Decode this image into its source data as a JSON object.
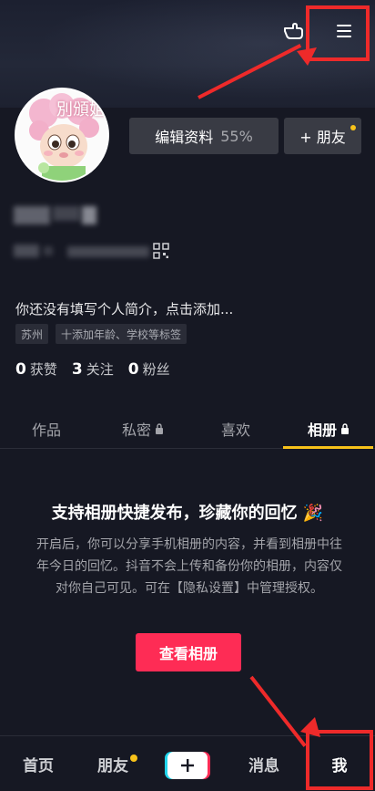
{
  "profile": {
    "avatar_caption": "別頒姐",
    "edit_label": "编辑资料",
    "edit_progress": "55%",
    "friend_label": "+ 朋友",
    "bio": "你还没有填写个人简介，点击添加...",
    "tags": [
      "苏州",
      "十添加年龄、学校等标签"
    ]
  },
  "stats": {
    "likes_count": "0",
    "likes_label": "获赞",
    "following_count": "3",
    "following_label": "关注",
    "fans_count": "0",
    "fans_label": "粉丝"
  },
  "tabs": [
    {
      "label": "作品",
      "locked": false
    },
    {
      "label": "私密",
      "locked": true
    },
    {
      "label": "喜欢",
      "locked": false
    },
    {
      "label": "相册",
      "locked": true,
      "active": true
    }
  ],
  "album": {
    "title": "支持相册快捷发布，珍藏你的回忆 🎉",
    "description": "开启后，你可以分享手机相册的内容，并看到相册中往年今日的回忆。抖音不会上传和备份你的相册，内容仅对你自己可见。可在【隐私设置】中管理授权。",
    "button_label": "查看相册"
  },
  "nav": {
    "home": "首页",
    "friends": "朋友",
    "messages": "消息",
    "me": "我"
  },
  "colors": {
    "background": "#161823",
    "accent_red": "#fe2c55",
    "accent_yellow": "#f7c21a",
    "annotation_red": "#ee2a2a"
  },
  "icons": [
    "hand-pointer-icon",
    "menu-icon",
    "lock-icon",
    "qr-code-icon",
    "plus-icon",
    "party-popper-icon"
  ]
}
